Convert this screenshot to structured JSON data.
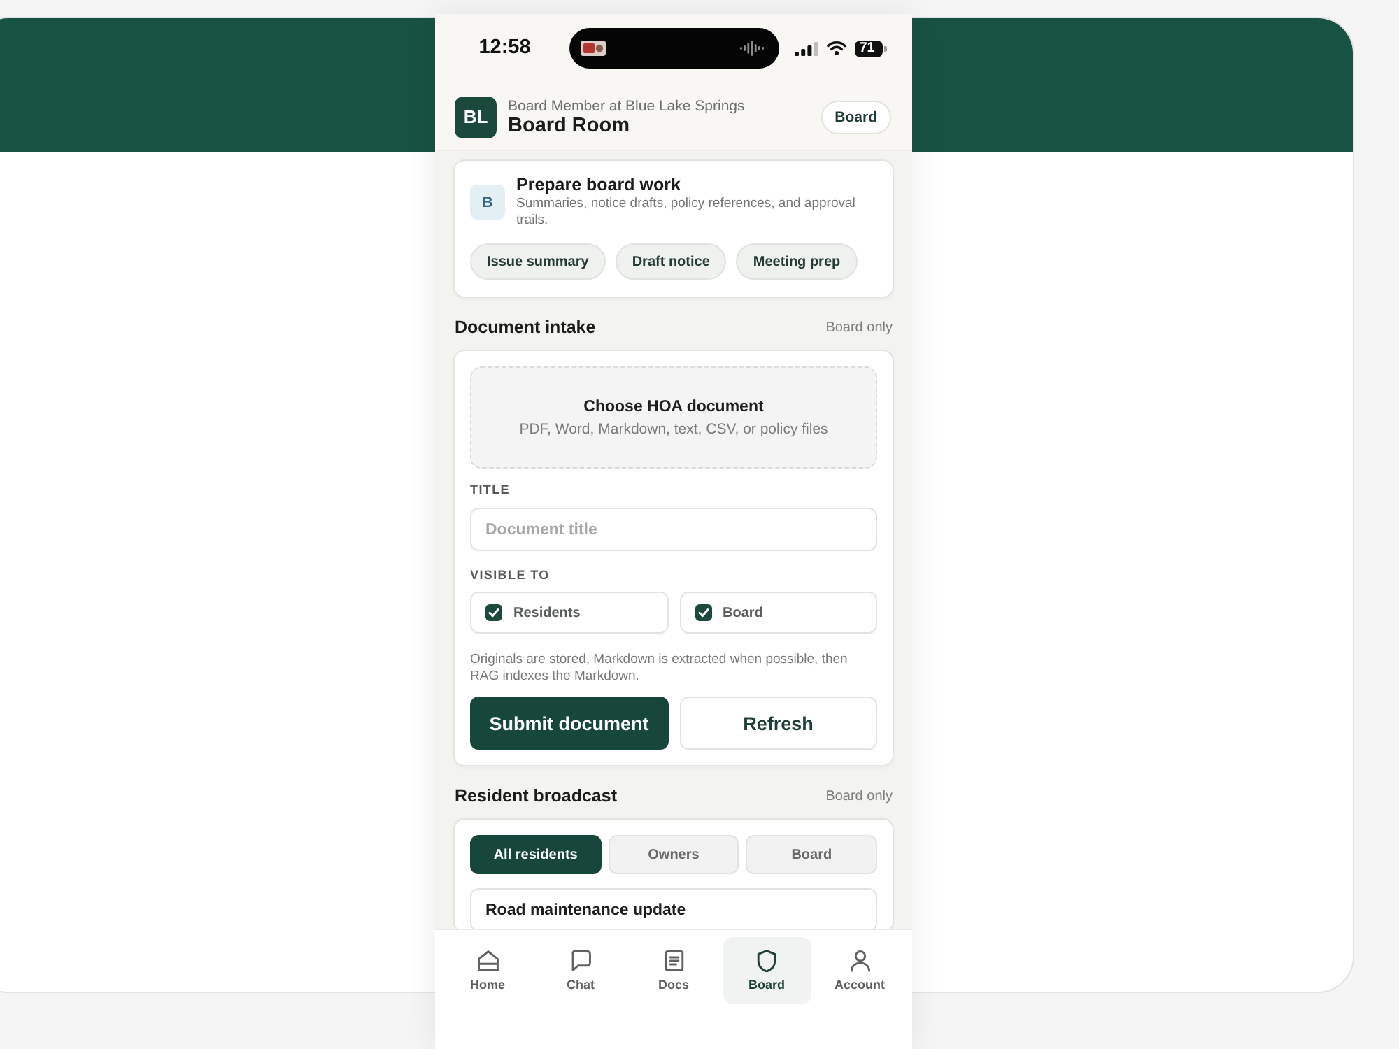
{
  "status_bar": {
    "time": "12:58",
    "battery": "71"
  },
  "header": {
    "avatar": "BL",
    "subtitle": "Board Member at Blue Lake Springs",
    "title": "Board Room",
    "role_button": "Board"
  },
  "intro_card": {
    "badge": "B",
    "title": "Prepare board work",
    "description": "Summaries, notice drafts, policy references, and approval trails.",
    "chips": [
      "Issue summary",
      "Draft notice",
      "Meeting prep"
    ]
  },
  "document_intake": {
    "title": "Document intake",
    "scope": "Board only",
    "dropzone": {
      "title": "Choose HOA document",
      "hint": "PDF, Word, Markdown, text, CSV, or policy files"
    },
    "title_field": {
      "label": "TITLE",
      "placeholder": "Document title"
    },
    "visibility": {
      "label": "VISIBLE TO",
      "options": [
        {
          "label": "Residents",
          "checked": true
        },
        {
          "label": "Board",
          "checked": true
        }
      ]
    },
    "note": "Originals are stored, Markdown is extracted when possible, then RAG indexes the Markdown.",
    "buttons": [
      {
        "label": "Submit document",
        "kind": "primary"
      },
      {
        "label": "Refresh",
        "kind": "secondary"
      }
    ]
  },
  "resident_broadcast": {
    "title": "Resident broadcast",
    "scope": "Board only",
    "audiences": [
      {
        "label": "All residents",
        "selected": true
      },
      {
        "label": "Owners",
        "selected": false
      },
      {
        "label": "Board",
        "selected": false
      }
    ],
    "subject_field": {
      "value": "Road maintenance update"
    }
  },
  "nav": [
    {
      "label": "Home",
      "selected": false
    },
    {
      "label": "Chat",
      "selected": false
    },
    {
      "label": "Docs",
      "selected": false
    },
    {
      "label": "Board",
      "selected": true
    },
    {
      "label": "Account",
      "selected": false
    }
  ]
}
